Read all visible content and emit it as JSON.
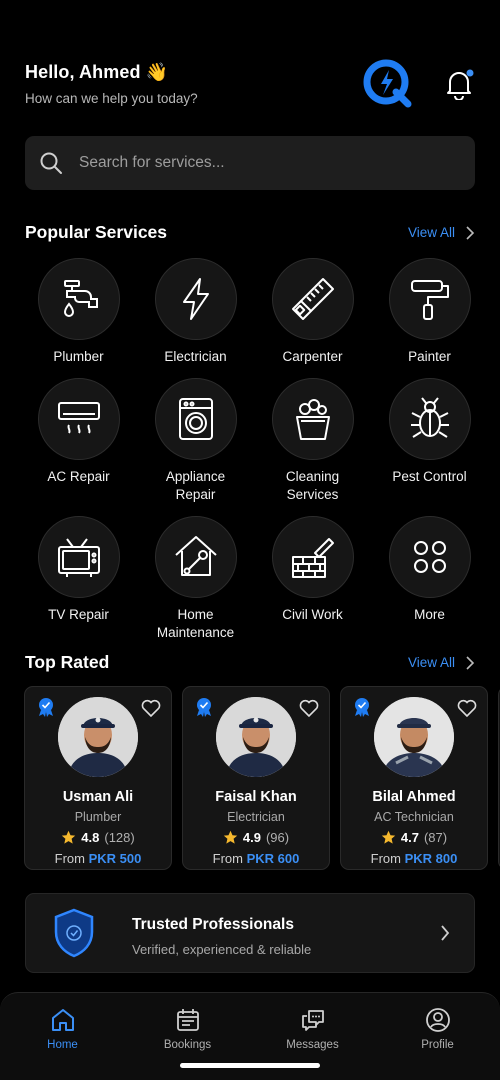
{
  "header": {
    "greeting": "Hello, Ahmed 👋",
    "subtitle": "How can we help you today?"
  },
  "search": {
    "placeholder": "Search for services..."
  },
  "popular": {
    "title": "Popular Services",
    "view_all": "View All",
    "services": [
      {
        "label": "Plumber",
        "icon": "faucet-icon"
      },
      {
        "label": "Electrician",
        "icon": "lightning-icon"
      },
      {
        "label": "Carpenter",
        "icon": "saw-icon"
      },
      {
        "label": "Painter",
        "icon": "paint-roller-icon"
      },
      {
        "label": "AC Repair",
        "icon": "air-conditioner-icon"
      },
      {
        "label": "Appliance\nRepair",
        "icon": "washing-machine-icon"
      },
      {
        "label": "Cleaning\nServices",
        "icon": "cleaning-bucket-icon"
      },
      {
        "label": "Pest Control",
        "icon": "bug-icon"
      },
      {
        "label": "TV Repair",
        "icon": "tv-icon"
      },
      {
        "label": "Home\nMaintenance",
        "icon": "house-wrench-icon"
      },
      {
        "label": "Civil Work",
        "icon": "brick-trowel-icon"
      },
      {
        "label": "More",
        "icon": "grid-dots-icon"
      }
    ]
  },
  "top_rated": {
    "title": "Top Rated",
    "view_all": "View All",
    "pros": [
      {
        "name": "Usman Ali",
        "role": "Plumber",
        "rating": "4.8",
        "count": "(128)",
        "from": "From",
        "price": "PKR 500"
      },
      {
        "name": "Faisal Khan",
        "role": "Electrician",
        "rating": "4.9",
        "count": "(96)",
        "from": "From",
        "price": "PKR 600"
      },
      {
        "name": "Bilal Ahmed",
        "role": "AC Technician",
        "rating": "4.7",
        "count": "(87)",
        "from": "From",
        "price": "PKR 800"
      }
    ]
  },
  "trust": {
    "title": "Trusted Professionals",
    "subtitle": "Verified, experienced & reliable"
  },
  "nav": {
    "home": "Home",
    "bookings": "Bookings",
    "messages": "Messages",
    "profile": "Profile"
  },
  "colors": {
    "accent": "#3b8ff5",
    "background": "#000000",
    "card": "#151515",
    "star": "#f5b82e"
  }
}
